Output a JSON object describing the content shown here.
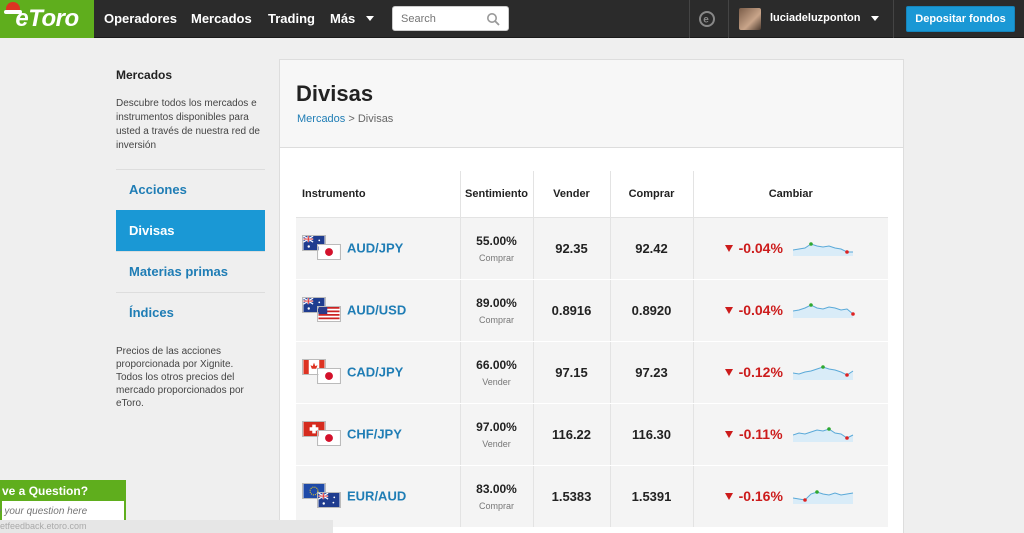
{
  "nav": {
    "logo": "eToro",
    "items": [
      "Operadores",
      "Mercados",
      "Trading",
      "Más"
    ],
    "search_placeholder": "Search",
    "username": "luciadeluzponton",
    "deposit": "Depositar fondos"
  },
  "sidebar": {
    "title": "Mercados",
    "description": "Descubre todos los mercados e instrumentos disponibles para usted a través de nuestra red de inversión",
    "items": [
      {
        "label": "Acciones",
        "active": false
      },
      {
        "label": "Divisas",
        "active": true
      },
      {
        "label": "Materias primas",
        "active": false
      },
      {
        "label": "Índices",
        "active": false
      }
    ],
    "note": "Precios de las acciones proporcionada por Xignite. Todos los otros precios del mercado proporcionados por eToro."
  },
  "main": {
    "title": "Divisas",
    "breadcrumb_link": "Mercados",
    "breadcrumb_sep": ">",
    "breadcrumb_current": "Divisas",
    "columns": [
      "Instrumento",
      "Sentimiento",
      "Vender",
      "Comprar",
      "Cambiar"
    ],
    "rows": [
      {
        "pair": "AUD/JPY",
        "flags": [
          "au",
          "jp"
        ],
        "sentiment": "55.00%",
        "side": "Comprar",
        "sell": "92.35",
        "buy": "92.42",
        "change": "-0.04%"
      },
      {
        "pair": "AUD/USD",
        "flags": [
          "au",
          "us"
        ],
        "sentiment": "89.00%",
        "side": "Comprar",
        "sell": "0.8916",
        "buy": "0.8920",
        "change": "-0.04%"
      },
      {
        "pair": "CAD/JPY",
        "flags": [
          "ca",
          "jp"
        ],
        "sentiment": "66.00%",
        "side": "Vender",
        "sell": "97.15",
        "buy": "97.23",
        "change": "-0.12%"
      },
      {
        "pair": "CHF/JPY",
        "flags": [
          "ch",
          "jp"
        ],
        "sentiment": "97.00%",
        "side": "Vender",
        "sell": "116.22",
        "buy": "116.30",
        "change": "-0.11%"
      },
      {
        "pair": "EUR/AUD",
        "flags": [
          "eu",
          "au"
        ],
        "sentiment": "83.00%",
        "side": "Comprar",
        "sell": "1.5383",
        "buy": "1.5391",
        "change": "-0.16%"
      }
    ]
  },
  "widget": {
    "title": "ve a Question?",
    "placeholder": "e your question here",
    "footer": "etfeedback.etoro.com"
  },
  "colors": {
    "brand_green": "#5fae1d",
    "accent_blue": "#1a98d5",
    "link_blue": "#1f7db5",
    "negative_red": "#cc1b1b"
  }
}
